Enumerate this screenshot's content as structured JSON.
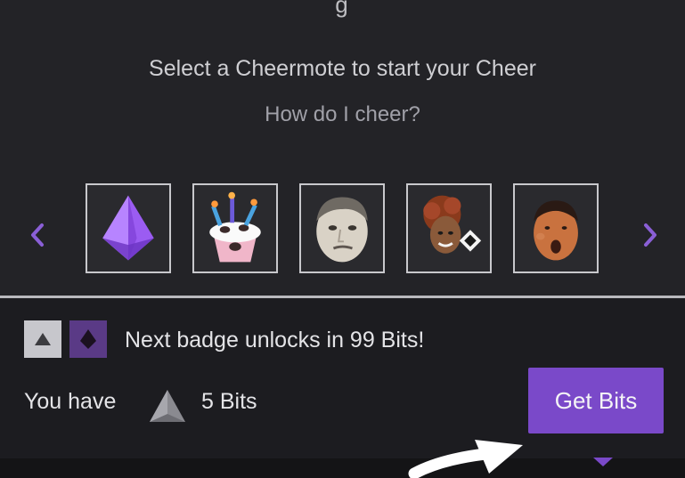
{
  "header": {
    "cut_title": "g"
  },
  "cheer": {
    "prompt": "Select a Cheermote to start your Cheer",
    "help_link": "How do I cheer?",
    "cheermotes": [
      {
        "name": "purple-gem-cheermote"
      },
      {
        "name": "cupcake-cheermote"
      },
      {
        "name": "kappa-face-cheermote"
      },
      {
        "name": "curly-hair-face-cheermote"
      },
      {
        "name": "surprised-face-cheermote"
      }
    ]
  },
  "badge": {
    "text": "Next badge unlocks in 99 Bits!",
    "current_icon": "gray-triangle-badge-icon",
    "next_icon": "purple-gem-badge-icon"
  },
  "balance": {
    "label": "You have",
    "amount": "5 Bits",
    "icon": "gray-bits-triangle-icon"
  },
  "actions": {
    "get_bits": "Get Bits"
  },
  "colors": {
    "accent": "#7a49c9",
    "nav_arrow": "#8a5fd6",
    "panel_bg": "#232327",
    "bottom_bg": "#1c1c20"
  }
}
